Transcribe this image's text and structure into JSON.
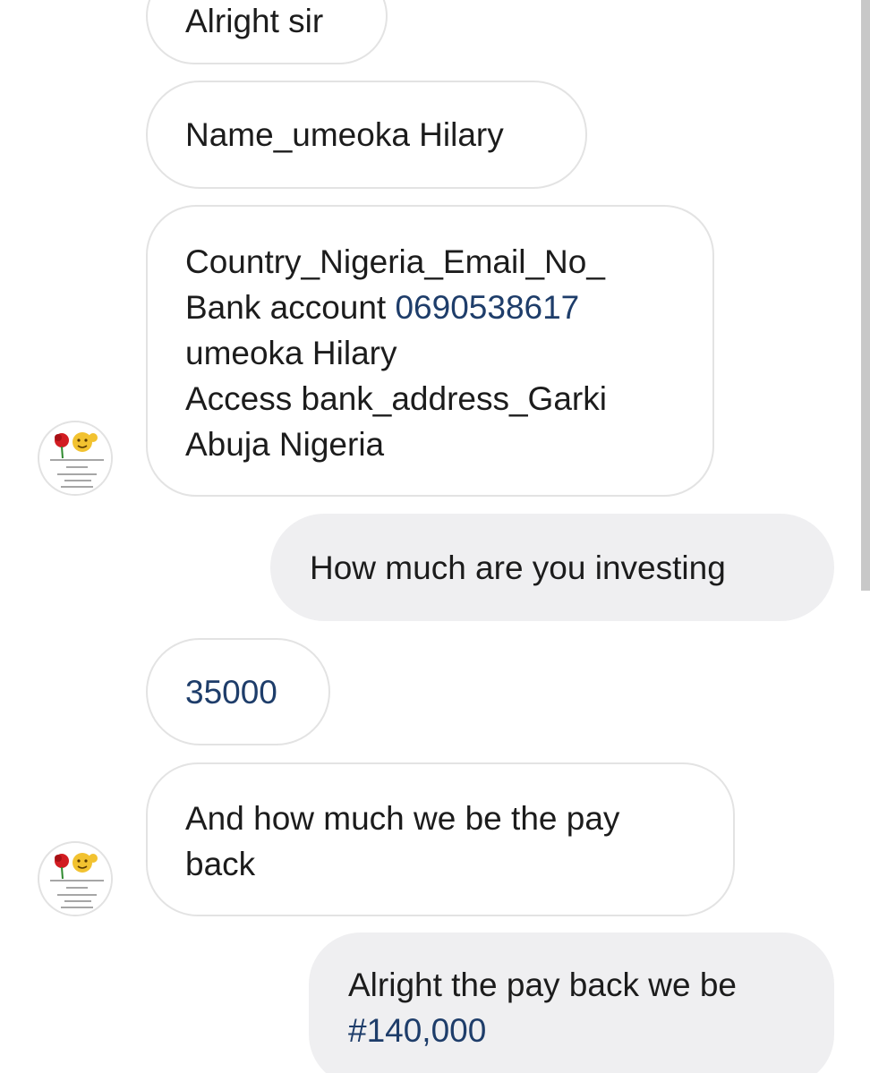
{
  "chat": {
    "messages": [
      {
        "side": "received",
        "lines": [
          "Alright sir"
        ]
      },
      {
        "side": "received",
        "lines": [
          "Name_umeoka Hilary"
        ]
      },
      {
        "side": "received",
        "lines": [
          "Country_Nigeria_Email_No_",
          "Bank account ",
          "0690538617",
          "umeoka Hilary",
          "Access bank_address_Garki",
          "Abuja Nigeria"
        ]
      },
      {
        "side": "sent",
        "lines": [
          "How much are you investing"
        ]
      },
      {
        "side": "received",
        "lines": [
          "35000"
        ]
      },
      {
        "side": "received",
        "lines": [
          "And how much we be the pay",
          "back"
        ]
      },
      {
        "side": "sent",
        "lines": [
          "Alright the pay back we be",
          "#140,000"
        ]
      }
    ]
  },
  "avatar": {
    "icon": "rose-and-emoji-avatar-icon"
  },
  "colors": {
    "received_bubble_bg": "#ffffff",
    "received_bubble_border": "#e3e3e3",
    "sent_bubble_bg": "#efeff1",
    "text": "#1c1c1c",
    "number_link": "#1e3d6a",
    "scrollbar": "#c8c8c8"
  }
}
